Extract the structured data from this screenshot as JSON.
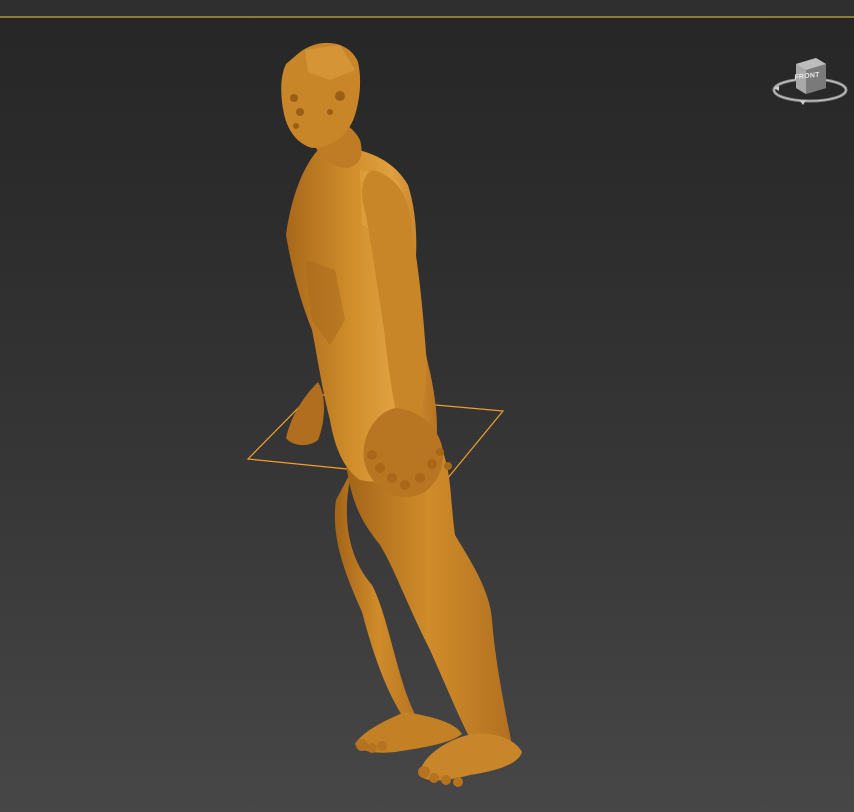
{
  "viewport": {
    "background_top": "#262626",
    "background_bottom": "#474747",
    "frame_accent": "#8b7a3a"
  },
  "model": {
    "material_color": "#c98628",
    "shade_color": "#a8681a",
    "highlight_color": "#e0a040",
    "selection_color": "#f0a030"
  },
  "viewcube": {
    "face_label": "FRONT",
    "icon": "viewcube-icon",
    "compass_icon": "compass-ring-icon"
  }
}
